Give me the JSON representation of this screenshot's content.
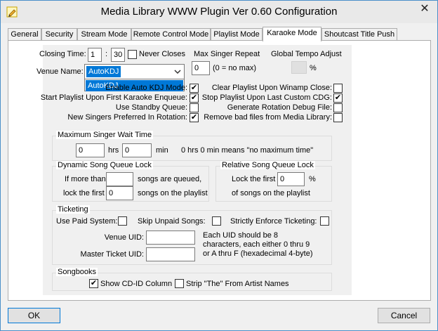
{
  "window": {
    "title": "Media Library WWW Plugin Ver 0.60 Configuration",
    "close_symbol": "✕"
  },
  "tabs": [
    {
      "label": "General"
    },
    {
      "label": "Security"
    },
    {
      "label": "Stream Mode"
    },
    {
      "label": "Remote Control Mode"
    },
    {
      "label": "Playlist Mode"
    },
    {
      "label": "Karaoke Mode"
    },
    {
      "label": "Shoutcast Title Push"
    }
  ],
  "top": {
    "closing_time_label": "Closing Time:",
    "closing_hour": "1",
    "closing_sep": ":",
    "closing_min": "30",
    "never_closes_label": "Never Closes",
    "max_singer_repeat_label": "Max Singer Repeat",
    "max_singer_value": "0",
    "max_singer_hint": "(0 = no max)",
    "global_tempo_label": "Global Tempo Adjust",
    "global_tempo_unit": "%",
    "venue_name_label": "Venue Name:",
    "venue_name_value": "AutoKDJ",
    "venue_dropdown_option": "AutoKDJ"
  },
  "options": {
    "enable_obscured": "Enable Auto KDJ Mode:",
    "clear_playlist": "Clear Playlist Upon Winamp Close:",
    "start_playlist": "Start Playlist Upon First Karaoke Enqueue:",
    "stop_playlist": "Stop Playlist Upon Last Custom CDG:",
    "standby_queue": "Use Standby Queue:",
    "rotation_debug": "Generate Rotation Debug File:",
    "new_singers": "New Singers Preferred In Rotation:",
    "remove_bad": "Remove bad files from Media Library:",
    "checked": "✔"
  },
  "max_wait": {
    "title": "Maximum Singer Wait Time",
    "hrs_value": "0",
    "hrs_label": "hrs",
    "min_value": "0",
    "min_label": "min",
    "hint": "0 hrs 0 min means \"no maximum time\""
  },
  "dynamic_lock": {
    "title": "Dynamic Song Queue Lock",
    "if_more_than": "If more than",
    "songs_queued": "songs are queued,",
    "lock_first": "lock the first",
    "songs_playlist": "songs on the playlist",
    "queued_value": "",
    "lock_value": "0"
  },
  "relative_lock": {
    "title": "Relative Song Queue Lock",
    "lock_first": "Lock the first",
    "value": "0",
    "percent": "%",
    "songs_playlist": "of songs on the playlist"
  },
  "ticketing": {
    "title": "Ticketing",
    "use_paid": "Use Paid System:",
    "skip_unpaid": "Skip Unpaid Songs:",
    "strict": "Strictly Enforce Ticketing:",
    "venue_uid_label": "Venue UID:",
    "master_uid_label": "Master Ticket UID:",
    "venue_uid_value": "",
    "master_uid_value": "",
    "hint1": "Each UID should be 8",
    "hint2": "characters, each either 0 thru 9",
    "hint3": "or A thru F (hexadecimal 4-byte)"
  },
  "songbooks": {
    "title": "Songbooks",
    "show_cdid": "Show CD-ID Column",
    "strip_the": "Strip \"The\" From Artist Names"
  },
  "buttons": {
    "ok": "OK",
    "cancel": "Cancel"
  },
  "colors": {
    "accent": "#0078d7",
    "window_border": "#4a8fc9"
  }
}
